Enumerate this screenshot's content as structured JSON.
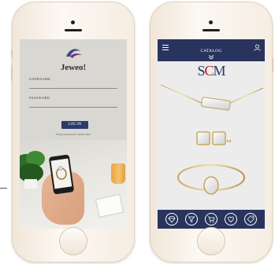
{
  "login": {
    "logo_text": "Jeweo!",
    "username_label": "USERNAME",
    "password_label": "PASSWORD",
    "login_button": "LOG IN",
    "forgot_text": "Forgot password? contact store"
  },
  "catalog": {
    "title": "CATALOG",
    "brand_left": "S",
    "brand_accent": "C",
    "brand_right": "M"
  }
}
